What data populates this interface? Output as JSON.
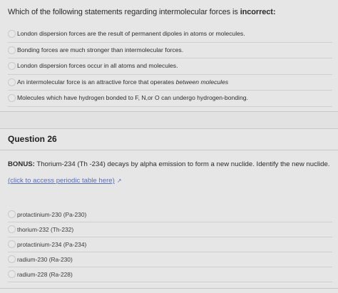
{
  "question25": {
    "prompt_prefix": "Which of the following statements regarding intermolecular forces is ",
    "prompt_emphasis": "incorrect:",
    "options": [
      {
        "label": "London dispersion forces are the result of permanent dipoles in atoms or molecules."
      },
      {
        "label": "Bonding forces are much stronger than intermolecular forces."
      },
      {
        "label": "London dispersion forces occur in all atoms and molecules."
      },
      {
        "label_prefix": "An intermolecular force is an attractive force that operates ",
        "label_emphasis": "between molecules"
      },
      {
        "label": "Molecules which have hydrogen bonded to F, N,or O can undergo hydrogen-bonding."
      }
    ]
  },
  "question26": {
    "title": "Question 26",
    "bonus_label": "BONUS:",
    "bonus_text": " Thorium-234 (Th -234) decays by alpha emission to form a new nuclide. Identify the new nuclide.",
    "link_text": "(click to access periodic table here)",
    "link_icon": "external-link-icon",
    "options": [
      {
        "label": "protactinium-230 (Pa-230)"
      },
      {
        "label": "thorium-232 (Th-232)"
      },
      {
        "label": "protactinium-234 (Pa-234)"
      },
      {
        "label": "radium-230 (Ra-230)"
      },
      {
        "label": "radium-228 (Ra-228)"
      }
    ]
  }
}
